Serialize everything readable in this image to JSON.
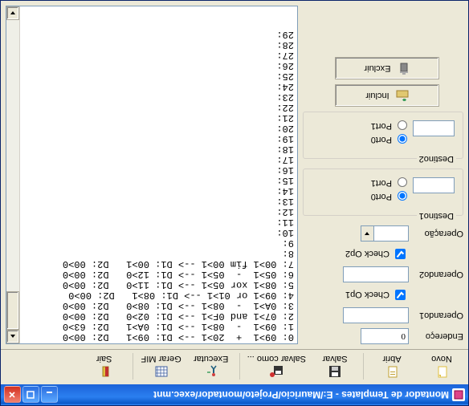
{
  "window": {
    "title": "Montador de Templates - E:/Mauricio/Projeto/montador/exec.mnt"
  },
  "toolbar": {
    "novo": "Novo",
    "abrir": "Abrir",
    "salvar": "Salvar",
    "salvar_como": "Salvar como ...",
    "executar": "Executar",
    "gerar_mif": "Gerar MIF",
    "sair": "Sair"
  },
  "form": {
    "endereco_label": "Endereço",
    "endereco_value": "0",
    "operando1_label": "Operando1",
    "operando1_value": "",
    "check_op1_label": "Check Op1",
    "check_op1_checked": true,
    "operando2_label": "Operando2",
    "operando2_value": "",
    "check_op2_label": "Check Op2",
    "check_op2_checked": true,
    "operacao_label": "Operação",
    "operacao_value": "",
    "destino1_legend": "Destino1",
    "destino2_legend": "Destino2",
    "port0_label": "Port0",
    "port1_label": "Port1",
    "destino1_value": "",
    "destino2_value": "",
    "incluir_label": "Incluir",
    "excluir_label": "Excluir"
  },
  "list": {
    "lines": [
      "0: 09>1  +  20>1 --> D1: 09>1   D2: 00>0",
      "1: 09>1  -  08>1 --> D1: 0A>1   D2: 63>0",
      "2: 07>1 and 0F>1 --> D1: 02>0   D2: 00>0",
      "3: 0A>1  -  08>1 --> D1: 08>0   D2: 00>0",
      "4: 09>1 or 01>1 --> D1: 08>1   D2: 00>0",
      "5: 08>1 xor 05>1 --> D1: 11>0   D2: 00>0",
      "6: 05>1  -  05>1 --> D1: 12>0   D2: 00>0",
      "7: 00>1 fim 00>1 --> D1: 00>1   D2: 00>0",
      "8:",
      "9:",
      "10:",
      "11:",
      "12:",
      "13:",
      "14:",
      "15:",
      "16:",
      "17:",
      "18:",
      "19:",
      "20:",
      "21:",
      "22:",
      "23:",
      "24:",
      "25:",
      "26:",
      "27:",
      "28:",
      "29:"
    ]
  }
}
